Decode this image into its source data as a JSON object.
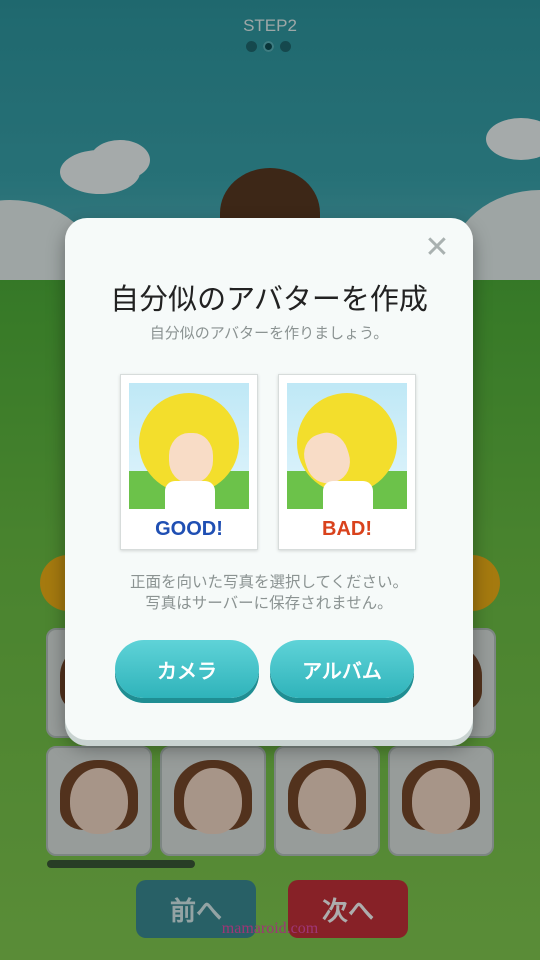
{
  "header": {
    "step_label": "STEP2",
    "dots": [
      false,
      true,
      false
    ]
  },
  "background": {
    "face_grid": [
      {
        "row": 1,
        "hair": "#7a4a2b"
      },
      {
        "row": 2,
        "hair": "#7a4a2b"
      }
    ],
    "nav": {
      "prev_label": "前へ",
      "next_label": "次へ"
    },
    "watermark": "mamaroid.com"
  },
  "dialog": {
    "title": "自分似のアバターを作成",
    "subtitle": "自分似のアバターを作りましょう。",
    "close_icon": "close-icon",
    "samples": [
      {
        "caption": "GOOD!",
        "color": "#1f4fb3"
      },
      {
        "caption": "BAD!",
        "color": "#d9421c"
      }
    ],
    "note_line1": "正面を向いた写真を選択してください。",
    "note_line2": "写真はサーバーに保存されません。",
    "camera_label": "カメラ",
    "album_label": "アルバム"
  },
  "colors": {
    "accent": "#3bbfc6",
    "next": "#c8323a",
    "prev": "#3b8e97"
  }
}
